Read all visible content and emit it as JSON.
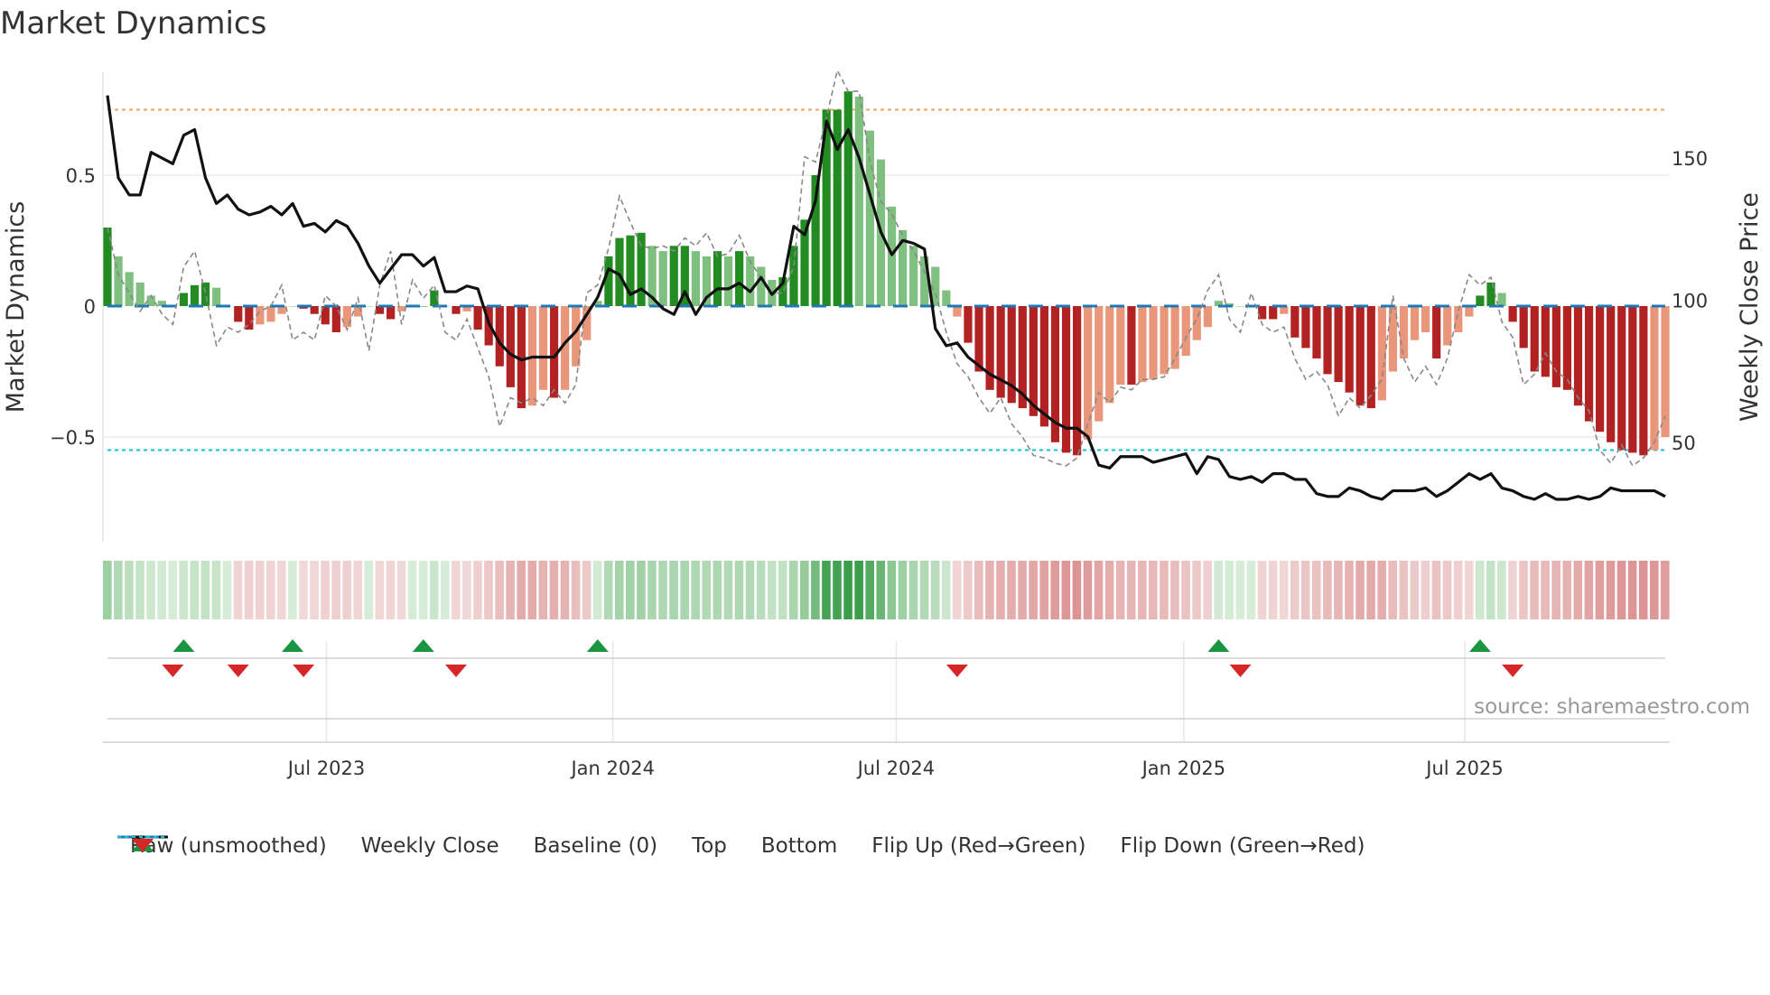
{
  "title": "Market Dynamics",
  "source": "source: sharemaestro.com",
  "colors": {
    "up_strong": "#228b22",
    "up_weak": "#7fbf7f",
    "down_strong": "#b22222",
    "down_weak": "#e9967a",
    "top": "#f4a460",
    "bottom": "#17becf",
    "baseline": "#1f77b4",
    "flip_up": "#1a9641",
    "flip_down": "#d62728"
  },
  "legend": [
    {
      "label": "Raw (unsmoothed)",
      "icon": "dashed-gray-line"
    },
    {
      "label": "Weekly Close",
      "icon": "solid-black-line"
    },
    {
      "label": "Baseline (0)",
      "icon": "dashed-blue-line"
    },
    {
      "label": "Top",
      "icon": "dotted-orange-line"
    },
    {
      "label": "Bottom",
      "icon": "dotted-cyan-line"
    },
    {
      "label": "Flip Up (Red→Green)",
      "icon": "triangle-up"
    },
    {
      "label": "Flip Down (Green→Red)",
      "icon": "triangle-down"
    }
  ],
  "chart_data": {
    "type": "bar",
    "title": "Market Dynamics",
    "ylabel": "Market Dynamics",
    "y2label": "Weekly Close Price",
    "ylim": [
      -0.9,
      0.9
    ],
    "y2lim": [
      20,
      175
    ],
    "yticks": [
      {
        "v": 0.5,
        "label": "0.5"
      },
      {
        "v": 0,
        "label": "0"
      },
      {
        "v": -0.5,
        "label": "−0.5"
      }
    ],
    "y2ticks": [
      {
        "v": 150,
        "label": "150"
      },
      {
        "v": 100,
        "label": "100"
      },
      {
        "v": 50,
        "label": "50"
      }
    ],
    "xticks": [
      {
        "week": 20.1,
        "label": "Jul 2023"
      },
      {
        "week": 46.4,
        "label": "Jan 2024"
      },
      {
        "week": 72.4,
        "label": "Jul 2024"
      },
      {
        "week": 98.8,
        "label": "Jan 2025"
      },
      {
        "week": 124.6,
        "label": "Jul 2025"
      }
    ],
    "top": 0.75,
    "bottom": -0.55,
    "baseline": 0,
    "values": [
      0.3,
      0.19,
      0.13,
      0.09,
      0.04,
      0.02,
      0.0,
      0.05,
      0.08,
      0.09,
      0.07,
      0.0,
      -0.06,
      -0.09,
      -0.07,
      -0.06,
      -0.03,
      0.0,
      -0.01,
      -0.03,
      -0.07,
      -0.1,
      -0.08,
      -0.04,
      0.0,
      -0.03,
      -0.05,
      -0.02,
      0.0,
      0.0,
      0.06,
      0.0,
      -0.03,
      -0.02,
      -0.09,
      -0.15,
      -0.23,
      -0.31,
      -0.39,
      -0.38,
      -0.32,
      -0.35,
      -0.32,
      -0.23,
      -0.13,
      0.02,
      0.19,
      0.26,
      0.27,
      0.28,
      0.23,
      0.21,
      0.23,
      0.23,
      0.21,
      0.19,
      0.21,
      0.19,
      0.21,
      0.19,
      0.15,
      0.1,
      0.11,
      0.23,
      0.33,
      0.5,
      0.75,
      0.75,
      0.82,
      0.8,
      0.67,
      0.56,
      0.38,
      0.29,
      0.23,
      0.19,
      0.15,
      0.06,
      -0.04,
      -0.14,
      -0.25,
      -0.32,
      -0.35,
      -0.37,
      -0.39,
      -0.42,
      -0.46,
      -0.52,
      -0.56,
      -0.57,
      -0.51,
      -0.44,
      -0.37,
      -0.3,
      -0.3,
      -0.29,
      -0.28,
      -0.26,
      -0.24,
      -0.19,
      -0.13,
      -0.08,
      0.02,
      0.01,
      0.0,
      0.0,
      -0.05,
      -0.05,
      -0.03,
      -0.12,
      -0.16,
      -0.2,
      -0.26,
      -0.29,
      -0.33,
      -0.38,
      -0.39,
      -0.36,
      -0.25,
      -0.2,
      -0.13,
      -0.1,
      -0.2,
      -0.15,
      -0.1,
      -0.04,
      0.04,
      0.09,
      0.05,
      -0.06,
      -0.16,
      -0.25,
      -0.27,
      -0.31,
      -0.32,
      -0.38,
      -0.44,
      -0.48,
      -0.52,
      -0.55,
      -0.56,
      -0.57,
      -0.55,
      -0.5
    ],
    "raw": [
      0.3,
      0.12,
      0.05,
      -0.02,
      0.04,
      -0.03,
      -0.07,
      0.15,
      0.21,
      0.05,
      -0.15,
      -0.08,
      -0.1,
      -0.07,
      -0.02,
      0.0,
      0.08,
      -0.13,
      -0.1,
      -0.13,
      0.04,
      0.0,
      -0.09,
      0.03,
      -0.17,
      0.08,
      0.21,
      -0.07,
      0.1,
      0.03,
      0.08,
      -0.1,
      -0.13,
      -0.05,
      -0.16,
      -0.27,
      -0.46,
      -0.35,
      -0.37,
      -0.35,
      -0.38,
      -0.32,
      -0.37,
      -0.3,
      0.05,
      0.08,
      0.22,
      0.42,
      0.32,
      0.23,
      0.22,
      0.23,
      0.21,
      0.26,
      0.23,
      0.28,
      0.19,
      0.2,
      0.27,
      0.17,
      0.11,
      0.05,
      0.05,
      0.15,
      0.57,
      0.55,
      0.72,
      0.9,
      0.82,
      0.82,
      0.55,
      0.4,
      0.35,
      0.27,
      0.21,
      0.13,
      0.05,
      -0.1,
      -0.22,
      -0.27,
      -0.35,
      -0.41,
      -0.35,
      -0.45,
      -0.5,
      -0.57,
      -0.58,
      -0.6,
      -0.61,
      -0.58,
      -0.45,
      -0.33,
      -0.37,
      -0.31,
      -0.32,
      -0.28,
      -0.28,
      -0.27,
      -0.2,
      -0.12,
      -0.05,
      0.06,
      0.12,
      -0.05,
      -0.1,
      0.05,
      -0.07,
      -0.1,
      -0.08,
      -0.2,
      -0.28,
      -0.25,
      -0.3,
      -0.42,
      -0.35,
      -0.39,
      -0.34,
      -0.28,
      0.04,
      -0.2,
      -0.29,
      -0.23,
      -0.3,
      -0.2,
      -0.02,
      0.12,
      0.08,
      0.11,
      -0.06,
      -0.12,
      -0.3,
      -0.26,
      -0.18,
      -0.25,
      -0.28,
      -0.35,
      -0.4,
      -0.55,
      -0.6,
      -0.53,
      -0.61,
      -0.58,
      -0.52,
      -0.42
    ],
    "close": [
      172,
      143,
      137,
      137,
      152,
      150,
      148,
      158,
      160,
      143,
      134,
      137,
      132,
      130,
      131,
      133,
      130,
      134,
      126,
      127,
      124,
      128,
      126,
      120,
      112,
      106,
      111,
      116,
      116,
      112,
      115,
      103,
      103,
      105,
      104,
      92,
      85,
      81,
      79,
      80,
      80,
      80,
      85,
      89,
      95,
      101,
      111,
      109,
      102,
      104,
      101,
      97,
      95,
      103,
      95,
      101,
      104,
      104,
      106,
      103,
      108,
      102,
      106,
      126,
      123,
      135,
      163,
      153,
      160,
      150,
      137,
      124,
      116,
      121,
      120,
      118,
      90,
      84,
      85,
      80,
      77,
      74,
      72,
      70,
      67,
      63,
      60,
      57,
      55,
      55,
      52,
      42,
      41,
      45,
      45,
      45,
      43,
      44,
      45,
      46,
      39,
      45,
      44,
      38,
      37,
      38,
      36,
      39,
      39,
      37,
      37,
      32,
      31,
      31,
      34,
      33,
      31,
      30,
      33,
      33,
      33,
      34,
      31,
      33,
      36,
      39,
      37,
      39,
      34,
      33,
      31,
      30,
      32,
      30,
      30,
      31,
      30,
      31,
      34,
      33,
      33,
      33,
      33,
      31
    ],
    "flip_up_weeks": [
      7,
      17,
      29,
      45,
      102,
      126
    ],
    "flip_down_weeks": [
      6,
      12,
      18,
      32,
      78,
      104,
      129
    ]
  }
}
